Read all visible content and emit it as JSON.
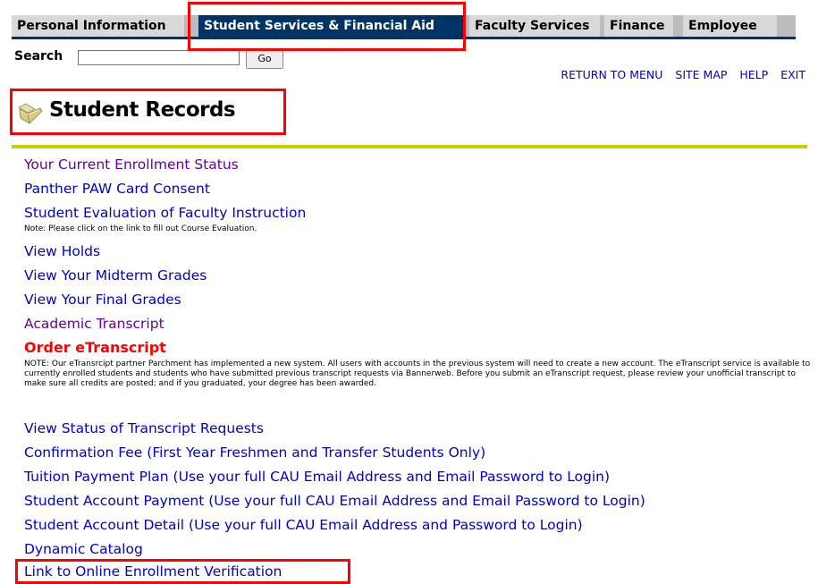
{
  "tabs": [
    {
      "label": "Personal Information"
    },
    {
      "label": "Student Services & Financial Aid"
    },
    {
      "label": "Faculty Services"
    },
    {
      "label": "Finance"
    },
    {
      "label": "Employee"
    }
  ],
  "search": {
    "label": "Search",
    "value": "",
    "go_label": "Go"
  },
  "topnav": {
    "return": "RETURN TO MENU",
    "sitemap": "SITE MAP",
    "help": "HELP",
    "exit": "EXIT"
  },
  "header": {
    "title": "Student Records",
    "icon": "folder-icon"
  },
  "links": [
    {
      "label": "Your Current Enrollment Status"
    },
    {
      "label": "Panther PAW Card Consent"
    },
    {
      "label": "Student Evaluation of Faculty Instruction"
    },
    {
      "label": "View Holds"
    },
    {
      "label": "View Your Midterm Grades"
    },
    {
      "label": "View Your Final Grades"
    },
    {
      "label": "Academic Transcript"
    },
    {
      "label": "Order eTranscript"
    },
    {
      "label": "View Status of Transcript Requests"
    },
    {
      "label": "Confirmation Fee (First Year Freshmen and Transfer Students Only)"
    },
    {
      "label": "Tuition Payment Plan (Use your full CAU Email Address and Email Password to Login)"
    },
    {
      "label": "Student Account Payment (Use your full CAU Email Address and Email Password to Login)"
    },
    {
      "label": "Student Account Detail (Use your full CAU Email Address and Password to Login)"
    },
    {
      "label": "Dynamic Catalog"
    },
    {
      "label": "Link to Online Enrollment Verification"
    }
  ],
  "notes": {
    "evaluation": "Note: Please click on the link to fill out Course Evaluation.",
    "etranscript": "NOTE: Our eTransrcipt partner Parchment has implemented a new system. All users with accounts in the previous system will need to create a new account. The eTranscript service is available to currently enrolled students and students who have submitted previous transcript requests via Bannerweb. Before you submit an eTranscript request, please review your unofficial transcript to make sure all credits are posted; and if you graduated, your degree has been awarded."
  },
  "colors": {
    "link": "#0000cc",
    "visited_link": "#660099",
    "emphasis_link": "#ff0000",
    "active_tab": "#003366",
    "divider": "#cccc00",
    "highlight": "#ff0000"
  }
}
